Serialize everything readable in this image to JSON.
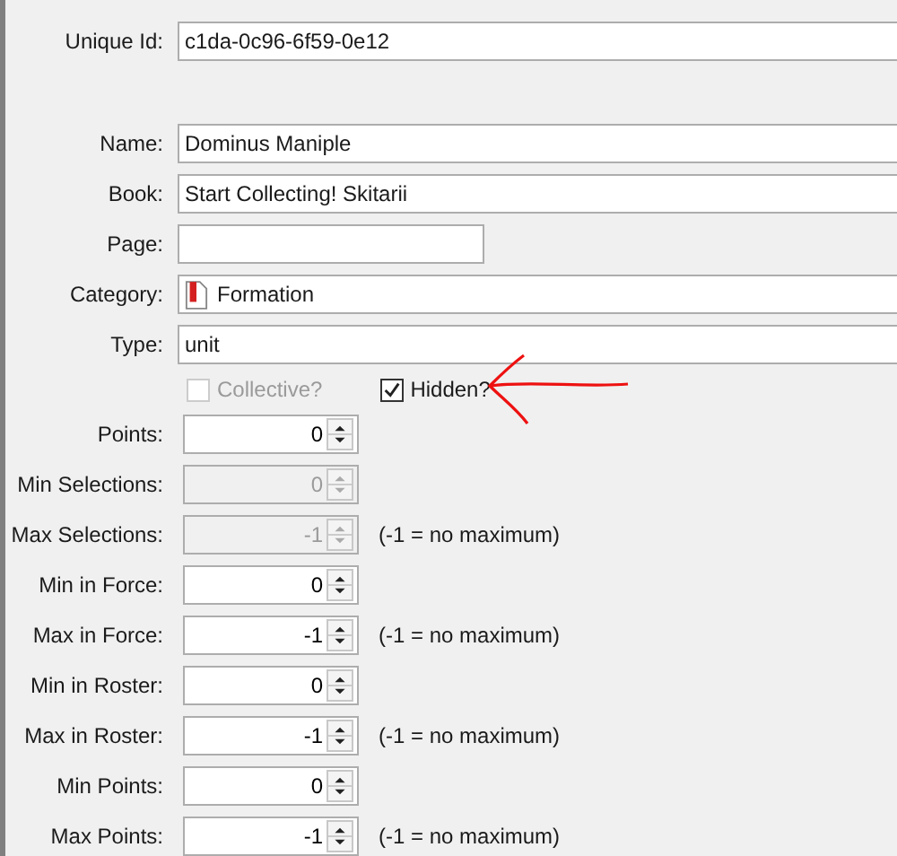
{
  "unique_id": {
    "label": "Unique Id:",
    "value": "c1da-0c96-6f59-0e12"
  },
  "fields": [
    {
      "kind": "text",
      "label": "Name:",
      "value": "Dominus Maniple"
    },
    {
      "kind": "text",
      "label": "Book:",
      "value": "Start Collecting! Skitarii"
    },
    {
      "kind": "short",
      "label": "Page:"
    },
    {
      "kind": "category",
      "label": "Category:",
      "value": "Formation"
    },
    {
      "kind": "text",
      "label": "Type:",
      "value": "unit"
    }
  ],
  "checkboxes": [
    {
      "label": "Collective?",
      "checked": false,
      "disabled": true
    },
    {
      "label": "Hidden?",
      "checked": true,
      "disabled": false
    }
  ],
  "spinners": [
    {
      "label": "Points:",
      "value": "0",
      "disabled": false
    },
    {
      "label": "Min Selections:",
      "value": "0",
      "disabled": true
    },
    {
      "label": "Max Selections:",
      "value": "-1",
      "disabled": true,
      "note": "(-1 = no maximum)"
    },
    {
      "label": "Min in Force:",
      "value": "0",
      "disabled": false
    },
    {
      "label": "Max in Force:",
      "value": "-1",
      "disabled": false,
      "note": "(-1 = no maximum)"
    },
    {
      "label": "Min in Roster:",
      "value": "0",
      "disabled": false
    },
    {
      "label": "Max in Roster:",
      "value": "-1",
      "disabled": false,
      "note": "(-1 = no maximum)"
    },
    {
      "label": "Min Points:",
      "value": "0",
      "disabled": false
    },
    {
      "label": "Max Points:",
      "value": "-1",
      "disabled": false,
      "note": "(-1 = no maximum)"
    }
  ]
}
